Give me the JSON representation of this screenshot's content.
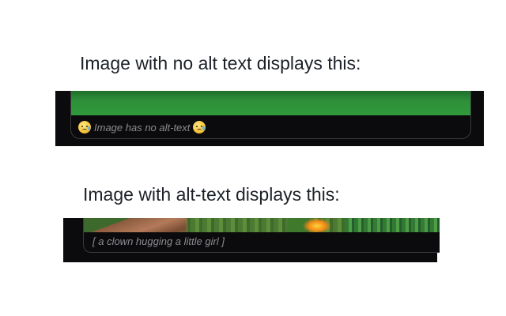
{
  "heading_no_alt": "Image with no alt text displays this:",
  "heading_alt": "Image with alt-text displays this:",
  "demo_no_alt": {
    "caption": "Image has no alt-text",
    "leading_icon": "crying-face-icon",
    "trailing_icon": "crying-face-icon"
  },
  "demo_alt": {
    "caption": "[ a clown hugging a little girl ]"
  },
  "colors": {
    "card_background": "#0b0a0c",
    "caption_text": "#8c8c92",
    "heading_text": "#1d2228",
    "image_green": "#2f9a3c"
  }
}
